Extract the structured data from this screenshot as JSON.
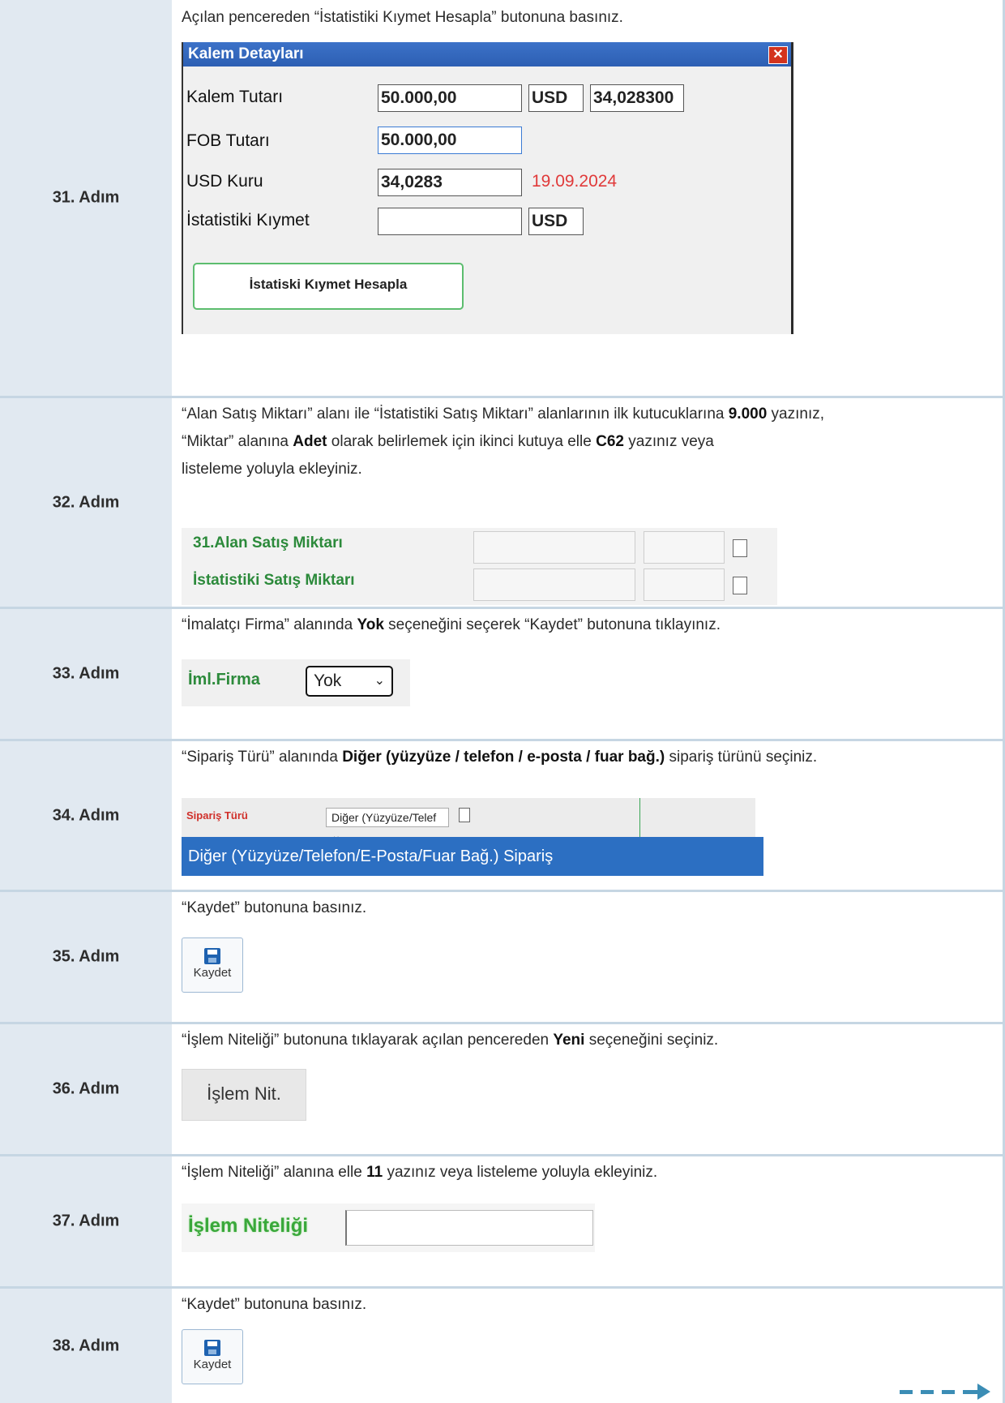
{
  "rows": [
    {
      "step": "31. Adım",
      "text": "Açılan pencereden “İstatistiki Kıymet Hesapla” butonuna basınız."
    },
    {
      "step": "32. Adım",
      "line1a": "“Alan Satış Miktarı” alanı ile “İstatistiki Satış Miktarı” alanlarının ilk kutucuklarına ",
      "line1b": "9.000",
      "line1c": " yazınız,",
      "line2a": "“Miktar” alanına ",
      "line2b": "Adet",
      "line2c": " olarak belirlemek için ikinci kutuya elle ",
      "line2d": "C62",
      "line2e": " yazınız veya",
      "line3": "listeleme yoluyla ekleyiniz."
    },
    {
      "step": "33. Adım",
      "a": "“İmalatçı Firma” alanında ",
      "b": "Yok",
      "c": " seçeneğini seçerek “Kaydet” butonuna tıklayınız."
    },
    {
      "step": "34. Adım",
      "a": "“Sipariş Türü” alanında ",
      "b": "Diğer (yüzyüze / telefon / e-posta / fuar bağ.)",
      "c": " sipariş türünü seçiniz."
    },
    {
      "step": "35. Adım",
      "text": "“Kaydet” butonuna basınız."
    },
    {
      "step": "36. Adım",
      "a": "“İşlem Niteliği” butonuna tıklayarak açılan pencereden ",
      "b": "Yeni",
      "c": " seçeneğini seçiniz."
    },
    {
      "step": "37. Adım",
      "a": "“İşlem Niteliği” alanına elle ",
      "b": "11",
      "c": " yazınız veya listeleme yoluyla ekleyiniz."
    },
    {
      "step": "38. Adım",
      "text": "“Kaydet” butonuna basınız."
    }
  ],
  "kalem": {
    "title": "Kalem Detayları",
    "close": "x",
    "kalem_tutari_label": "Kalem Tutarı",
    "kalem_tutari": "50.000,00",
    "kalem_cur": "USD",
    "kalem_rate": "34,028300",
    "fob_label": "FOB Tutarı",
    "fob": "50.000,00",
    "usd_label": "USD Kuru",
    "usd": "34,0283",
    "usd_date": "19.09.2024",
    "ist_label": "İstatistiki Kıymet",
    "ist_value": "",
    "ist_cur": "USD",
    "button": "İstatiski Kıymet Hesapla"
  },
  "satis": {
    "alan_label": "31.Alan Satış Miktarı",
    "ist_label": "İstatistiki Satış Miktarı"
  },
  "firma": {
    "label": "İml.Firma",
    "value": "Yok"
  },
  "siparis": {
    "label": "Sipariş Türü",
    "select": "Diğer (Yüzyüze/Telef",
    "option": "Diğer (Yüzyüze/Telefon/E-Posta/Fuar Bağ.) Sipariş"
  },
  "kaydet": {
    "label": "Kaydet"
  },
  "islem": {
    "button": "İşlem Nit.",
    "field_label": "İşlem Niteliği"
  },
  "colors": {
    "step_bg": "#e1e9f1",
    "green": "#2c8a3b",
    "title_blue": "#2d5fb3",
    "date_red": "#e03a3a"
  }
}
